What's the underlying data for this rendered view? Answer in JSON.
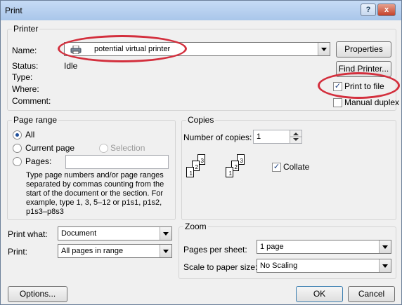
{
  "window": {
    "title": "Print",
    "help_label": "?",
    "close_label": "x"
  },
  "printer": {
    "group_label": "Printer",
    "name_label": "Name:",
    "name_value": "potential virtual printer",
    "status_label": "Status:",
    "status_value": "Idle",
    "type_label": "Type:",
    "where_label": "Where:",
    "comment_label": "Comment:",
    "properties_label": "Properties",
    "find_printer_label": "Find Printer...",
    "print_to_file_label": "Print to file",
    "print_to_file_checked": true,
    "manual_duplex_label": "Manual duplex",
    "manual_duplex_checked": false
  },
  "page_range": {
    "group_label": "Page range",
    "all_label": "All",
    "current_page_label": "Current page",
    "selection_label": "Selection",
    "pages_label": "Pages:",
    "pages_value": "",
    "help_text": "Type page numbers and/or page ranges separated by commas counting from the start of the document or the section. For example, type 1, 3, 5–12 or p1s1, p1s2, p1s3–p8s3",
    "selected": "All"
  },
  "copies": {
    "group_label": "Copies",
    "number_label": "Number of copies:",
    "number_value": "1",
    "collate_label": "Collate",
    "collate_checked": true,
    "page_numbers": [
      "1",
      "2",
      "3"
    ]
  },
  "print_what": {
    "label": "Print what:",
    "value": "Document"
  },
  "print": {
    "label": "Print:",
    "value": "All pages in range"
  },
  "zoom": {
    "group_label": "Zoom",
    "pages_per_sheet_label": "Pages per sheet:",
    "pages_per_sheet_value": "1 page",
    "scale_label": "Scale to paper size:",
    "scale_value": "No Scaling"
  },
  "buttons": {
    "options": "Options...",
    "ok": "OK",
    "cancel": "Cancel"
  },
  "colors": {
    "highlight_ring": "#d32f3d",
    "title_bar": "#b9d1f0"
  }
}
